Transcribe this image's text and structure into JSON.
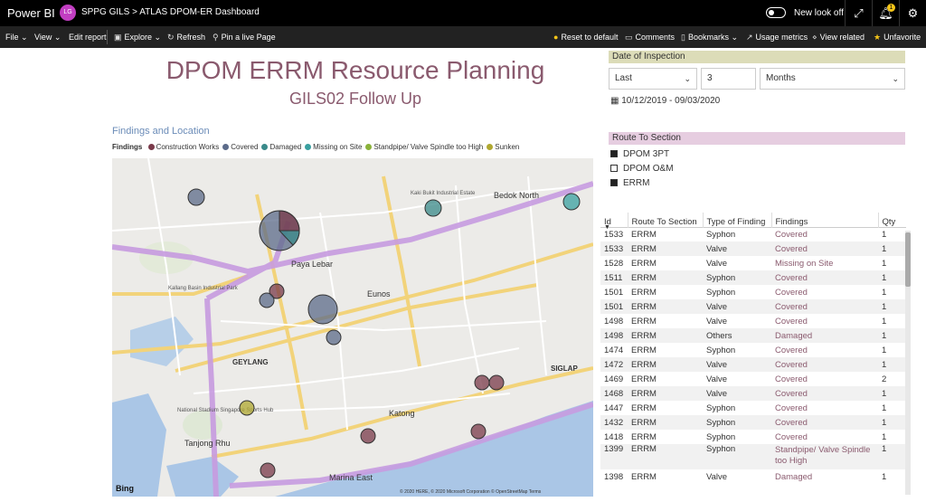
{
  "app": {
    "brand": "Power BI",
    "workspace_initials": "LG",
    "workspace": "SPPG GILS",
    "report": "ATLAS DPOM-ER Dashboard",
    "new_look": "New look off",
    "notif_count": "1"
  },
  "toolbar": {
    "file": "File",
    "view": "View",
    "edit": "Edit report",
    "explore": "Explore",
    "refresh": "Refresh",
    "pin": "Pin a live Page",
    "reset": "Reset to default",
    "comments": "Comments",
    "bookmarks": "Bookmarks",
    "usage": "Usage metrics",
    "related": "View related",
    "unfav": "Unfavorite"
  },
  "report": {
    "title": "DPOM ERRM Resource Planning",
    "subtitle": "GILS02 Follow Up"
  },
  "map": {
    "title": "Findings and Location",
    "legend_label": "Findings",
    "legend": [
      {
        "name": "Construction Works",
        "color": "#7a3a4a"
      },
      {
        "name": "Covered",
        "color": "#5c6b8a"
      },
      {
        "name": "Damaged",
        "color": "#3a8a8a"
      },
      {
        "name": "Missing on Site",
        "color": "#3aa0a0"
      },
      {
        "name": "Standpipe/ Valve Spindle too High",
        "color": "#8ab23a"
      },
      {
        "name": "Sunken",
        "color": "#b0a830"
      }
    ],
    "places": {
      "paya": "Paya Lebar",
      "eunos": "Eunos",
      "geylang": "GEYLANG",
      "katong": "Katong",
      "siglap": "SIGLAP",
      "bedok": "Bedok North",
      "tanjong": "Tanjong Rhu",
      "marina": "Marina East",
      "kaki": "Kaki Bukit Industrial Estate",
      "stadium": "National Stadium Singapore Sports Hub",
      "kallang": "Kallang Basin Industrial Park",
      "bing": "Bing",
      "copyright": "© 2020 HERE, © 2020 Microsoft Corporation  © OpenStreetMap  Terms"
    }
  },
  "date_slicer": {
    "header": "Date of Inspection",
    "mode": "Last",
    "count": "3",
    "unit": "Months",
    "range": "10/12/2019 - 09/03/2020"
  },
  "route_slicer": {
    "header": "Route To Section",
    "options": [
      {
        "label": "DPOM 3PT",
        "checked": true
      },
      {
        "label": "DPOM O&M",
        "checked": false
      },
      {
        "label": "ERRM",
        "checked": true
      }
    ]
  },
  "table": {
    "headers": [
      "Id",
      "Route To Section",
      "Type of Finding",
      "Findings",
      "Qty"
    ],
    "rows": [
      [
        "1533",
        "ERRM",
        "Syphon",
        "Covered",
        "1"
      ],
      [
        "1533",
        "ERRM",
        "Valve",
        "Covered",
        "1"
      ],
      [
        "1528",
        "ERRM",
        "Valve",
        "Missing on Site",
        "1"
      ],
      [
        "1511",
        "ERRM",
        "Syphon",
        "Covered",
        "1"
      ],
      [
        "1501",
        "ERRM",
        "Syphon",
        "Covered",
        "1"
      ],
      [
        "1501",
        "ERRM",
        "Valve",
        "Covered",
        "1"
      ],
      [
        "1498",
        "ERRM",
        "Valve",
        "Covered",
        "1"
      ],
      [
        "1498",
        "ERRM",
        "Others",
        "Damaged",
        "1"
      ],
      [
        "1474",
        "ERRM",
        "Syphon",
        "Covered",
        "1"
      ],
      [
        "1472",
        "ERRM",
        "Valve",
        "Covered",
        "1"
      ],
      [
        "1469",
        "ERRM",
        "Valve",
        "Covered",
        "2"
      ],
      [
        "1468",
        "ERRM",
        "Valve",
        "Covered",
        "1"
      ],
      [
        "1447",
        "ERRM",
        "Syphon",
        "Covered",
        "1"
      ],
      [
        "1432",
        "ERRM",
        "Syphon",
        "Covered",
        "1"
      ],
      [
        "1418",
        "ERRM",
        "Syphon",
        "Covered",
        "1"
      ],
      [
        "1399",
        "ERRM",
        "Syphon",
        "Standpipe/ Valve Spindle too High",
        "1"
      ],
      [
        "1398",
        "ERRM",
        "Valve",
        "Damaged",
        "1"
      ]
    ]
  }
}
